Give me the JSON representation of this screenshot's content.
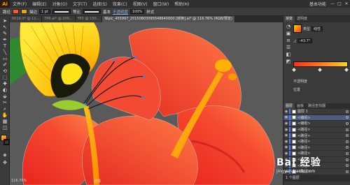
{
  "app": {
    "logo": "Ai",
    "menus": [
      "文件(F)",
      "编辑(E)",
      "对象(O)",
      "文字(T)",
      "选择(S)",
      "效果(C)",
      "视图(V)",
      "窗口(W)",
      "帮助(H)"
    ],
    "workspace": "基本功能",
    "window_buttons": [
      "—",
      "□",
      "✕"
    ]
  },
  "controlbar": {
    "path_label": "路径",
    "fill_color": "#ff5a1f",
    "stroke_color": "#f2a200",
    "stroke_label": "描边",
    "stroke_weight": "1 pt",
    "uniform_label": "等比",
    "basic_label": "基本",
    "opacity_label": "不透明度",
    "opacity_value": "100%",
    "style_label": "样式"
  },
  "tabs": [
    {
      "label": "0019.3* @ 11...",
      "active": false
    },
    {
      "label": "TP6.ai* @ 200...",
      "active": false
    },
    {
      "label": "TP2 @ 150...",
      "active": false
    },
    {
      "label": "Nipic_455997_20150803095548640000 [转换].ai* @ 116.76% (RGB/预览)",
      "active": true
    }
  ],
  "tools": [
    "➤",
    "↖",
    "✎",
    "✒",
    "T",
    "╲",
    "▭",
    "✐",
    "⟲",
    "⬚",
    "✚",
    "◐",
    "⬙",
    "✂",
    "⌕",
    "✋",
    "▦",
    "◫",
    "◈",
    "✥"
  ],
  "canvas": {
    "status": "116.76%",
    "readout": "选择"
  },
  "colors": {
    "petal_main": "#f23a2f",
    "petal_light": "#ff6a3a",
    "petal_dark": "#c81a20",
    "stamen": "#ffb300",
    "yellow_flower": "#ffd21a",
    "orange_flower": "#ff9a10",
    "leaf": "#2f8a2f"
  },
  "rightpanel": {
    "tabs": [
      "渐变",
      "透明度"
    ],
    "type_label": "类型",
    "type_value": "线性",
    "angle_value": "-43.7°",
    "opacity_label": "不透明度",
    "location_label": "位置",
    "strip_icons": [
      "◔",
      "▣",
      "≡",
      "☰",
      "◧",
      "◩"
    ]
  },
  "layers": {
    "tabs": [
      "图层",
      "画板",
      "路径查找器"
    ],
    "items": [
      {
        "name": "图层 1",
        "selected": false
      },
      {
        "name": "<编组>",
        "selected": true
      },
      {
        "name": "<编组>",
        "selected": false
      },
      {
        "name": "<路径>",
        "selected": false
      },
      {
        "name": "<路径>",
        "selected": false
      },
      {
        "name": "<路径>",
        "selected": false
      },
      {
        "name": "<路径>",
        "selected": false
      },
      {
        "name": "<路径>",
        "selected": false
      },
      {
        "name": "<路径>",
        "selected": false
      },
      {
        "name": "<路径>",
        "selected": false
      },
      {
        "name": "<路径>",
        "selected": false
      },
      {
        "name": "<路径>",
        "selected": false
      }
    ],
    "footer": "1 个图层"
  },
  "watermark": {
    "logo": "Bai 经验",
    "url": "jingyan.baidu.com"
  }
}
